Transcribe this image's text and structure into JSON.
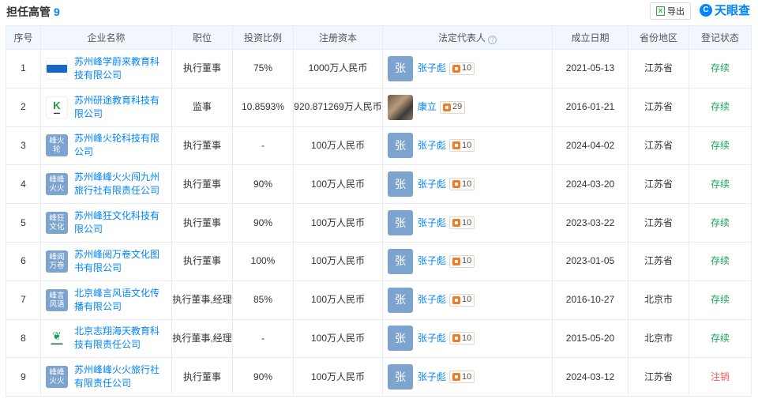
{
  "header": {
    "title": "担任高管",
    "count": "9",
    "export_label": "导出",
    "export_icon": "excel-icon",
    "brand": "天眼查"
  },
  "columns": {
    "no": "序号",
    "company": "企业名称",
    "position": "职位",
    "ratio": "投资比例",
    "capital": "注册资本",
    "rep": "法定代表人",
    "date": "成立日期",
    "province": "省份地区",
    "status": "登记状态"
  },
  "colors": {
    "accent": "#0084ff",
    "active": "#19a55a",
    "cancel": "#f25a5a",
    "avatar_bg": "#7ca4cf"
  },
  "rows": [
    {
      "no": "1",
      "logo_type": "img1",
      "logo_text": "",
      "company": "苏州峰学蔚来教育科技有限公司",
      "position": "执行董事",
      "ratio": "75%",
      "capital": "1000万人民币",
      "rep_avatar": "张",
      "rep": "张子彪",
      "rep_count": "10",
      "date": "2021-05-13",
      "province": "江苏省",
      "status": "存续",
      "status_type": "active"
    },
    {
      "no": "2",
      "logo_type": "img2",
      "logo_text": "",
      "company": "苏州研途教育科技有限公司",
      "position": "监事",
      "ratio": "10.8593%",
      "capital": "920.871269万人民币",
      "rep_avatar": "",
      "rep": "康立",
      "rep_count": "29",
      "date": "2016-01-21",
      "province": "江苏省",
      "status": "存续",
      "status_type": "active"
    },
    {
      "no": "3",
      "logo_type": "blue",
      "logo_text": "峰火轮",
      "company": "苏州峰火轮科技有限公司",
      "position": "执行董事",
      "ratio": "-",
      "capital": "100万人民币",
      "rep_avatar": "张",
      "rep": "张子彪",
      "rep_count": "10",
      "date": "2024-04-02",
      "province": "江苏省",
      "status": "存续",
      "status_type": "active"
    },
    {
      "no": "4",
      "logo_type": "blue",
      "logo_text": "峰峰火火",
      "company": "苏州峰峰火火闯九州旅行社有限责任公司",
      "position": "执行董事",
      "ratio": "90%",
      "capital": "100万人民币",
      "rep_avatar": "张",
      "rep": "张子彪",
      "rep_count": "10",
      "date": "2024-03-20",
      "province": "江苏省",
      "status": "存续",
      "status_type": "active"
    },
    {
      "no": "5",
      "logo_type": "blue",
      "logo_text": "峰狂文化",
      "company": "苏州峰狂文化科技有限公司",
      "position": "执行董事",
      "ratio": "90%",
      "capital": "100万人民币",
      "rep_avatar": "张",
      "rep": "张子彪",
      "rep_count": "10",
      "date": "2023-03-22",
      "province": "江苏省",
      "status": "存续",
      "status_type": "active"
    },
    {
      "no": "6",
      "logo_type": "blue",
      "logo_text": "峰阅万卷",
      "company": "苏州峰阅万卷文化图书有限公司",
      "position": "执行董事",
      "ratio": "100%",
      "capital": "100万人民币",
      "rep_avatar": "张",
      "rep": "张子彪",
      "rep_count": "10",
      "date": "2023-01-05",
      "province": "江苏省",
      "status": "存续",
      "status_type": "active"
    },
    {
      "no": "7",
      "logo_type": "blue",
      "logo_text": "峰言风语",
      "company": "北京峰言风语文化传播有限公司",
      "position": "执行董事,经理",
      "ratio": "85%",
      "capital": "100万人民币",
      "rep_avatar": "张",
      "rep": "张子彪",
      "rep_count": "10",
      "date": "2016-10-27",
      "province": "北京市",
      "status": "存续",
      "status_type": "active"
    },
    {
      "no": "8",
      "logo_type": "img3",
      "logo_text": "",
      "company": "北京志翔海天教育科技有限责任公司",
      "position": "执行董事,经理",
      "ratio": "-",
      "capital": "100万人民币",
      "rep_avatar": "张",
      "rep": "张子彪",
      "rep_count": "10",
      "date": "2015-05-20",
      "province": "北京市",
      "status": "存续",
      "status_type": "active"
    },
    {
      "no": "9",
      "logo_type": "blue",
      "logo_text": "峰峰火火",
      "company": "苏州峰峰火火旅行社有限责任公司",
      "position": "执行董事",
      "ratio": "90%",
      "capital": "100万人民币",
      "rep_avatar": "张",
      "rep": "张子彪",
      "rep_count": "10",
      "date": "2024-03-12",
      "province": "江苏省",
      "status": "注销",
      "status_type": "cancel"
    }
  ]
}
